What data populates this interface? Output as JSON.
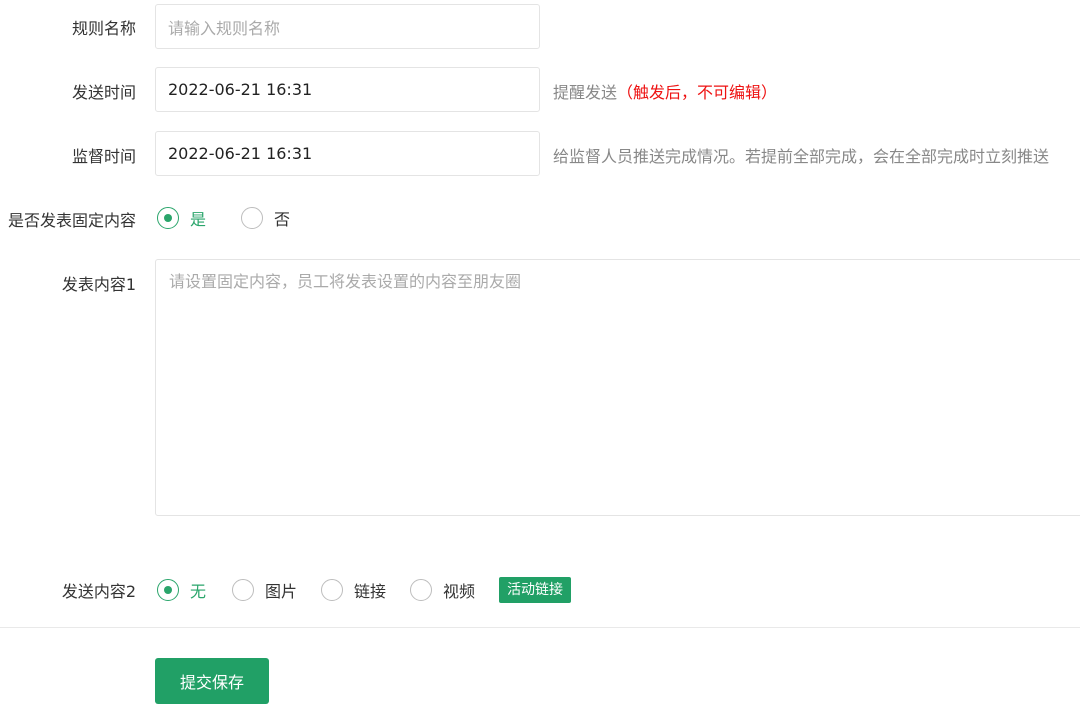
{
  "form": {
    "rule_name": {
      "label": "规则名称",
      "placeholder": "请输入规则名称"
    },
    "send_time": {
      "label": "发送时间",
      "value": "2022-06-21 16:31",
      "hint": "提醒发送",
      "hint_warning": "（触发后，不可编辑）"
    },
    "supervise_time": {
      "label": "监督时间",
      "value": "2022-06-21 16:31",
      "hint": "给监督人员推送完成情况。若提前全部完成，会在全部完成时立刻推送"
    },
    "fixed_content": {
      "label": "是否发表固定内容",
      "options": [
        {
          "label": "是",
          "checked": true
        },
        {
          "label": "否",
          "checked": false
        }
      ]
    },
    "content1": {
      "label": "发表内容1",
      "placeholder": "请设置固定内容，员工将发表设置的内容至朋友圈"
    },
    "content2": {
      "label": "发送内容2",
      "options": [
        {
          "label": "无",
          "checked": true
        },
        {
          "label": "图片",
          "checked": false
        },
        {
          "label": "链接",
          "checked": false
        },
        {
          "label": "视频",
          "checked": false
        }
      ],
      "tag": "活动链接"
    }
  },
  "submit_label": "提交保存",
  "colors": {
    "accent": "#2aa56b",
    "button": "#21a066",
    "warning": "#ee1111"
  }
}
